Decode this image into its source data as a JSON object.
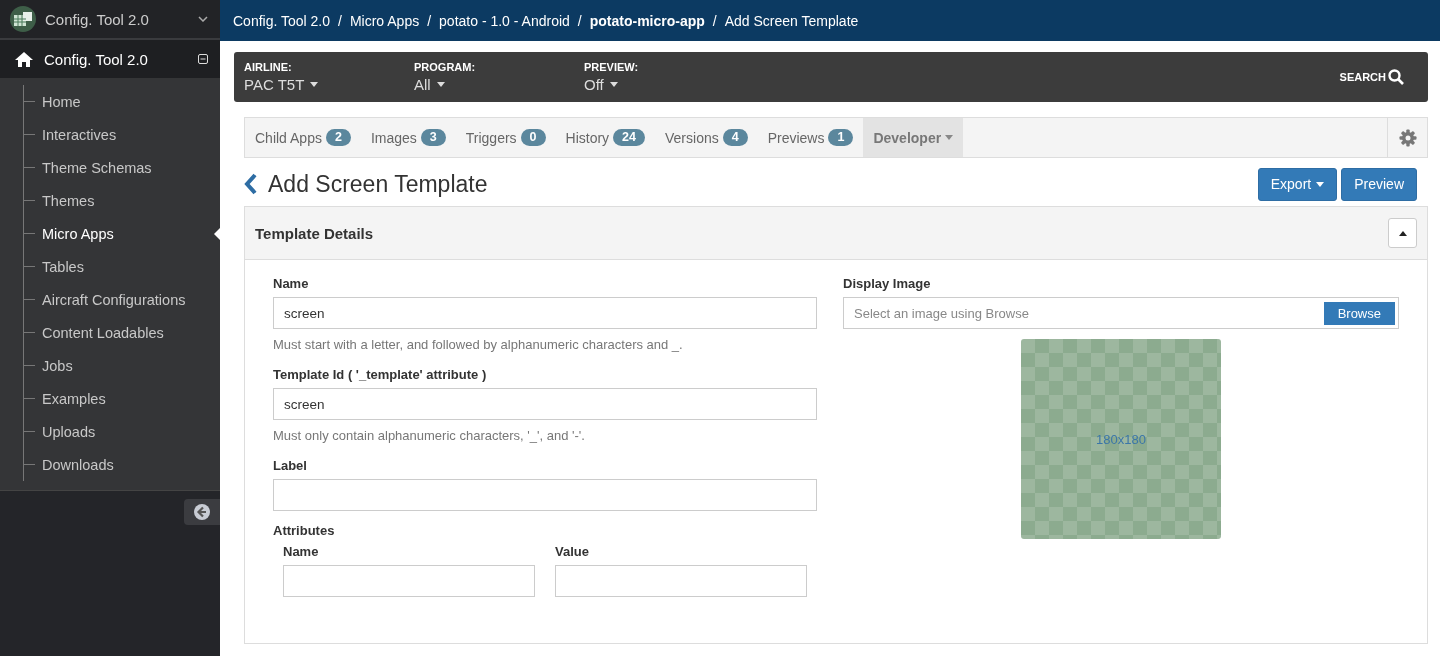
{
  "app_switcher": {
    "title": "Config. Tool 2.0"
  },
  "sidebar": {
    "root": {
      "label": "Config. Tool 2.0",
      "expanded": true
    },
    "items": [
      {
        "label": "Home",
        "selected": false
      },
      {
        "label": "Interactives",
        "selected": false
      },
      {
        "label": "Theme Schemas",
        "selected": false
      },
      {
        "label": "Themes",
        "selected": false
      },
      {
        "label": "Micro Apps",
        "selected": true
      },
      {
        "label": "Tables",
        "selected": false
      },
      {
        "label": "Aircraft Configurations",
        "selected": false
      },
      {
        "label": "Content Loadables",
        "selected": false
      },
      {
        "label": "Jobs",
        "selected": false
      },
      {
        "label": "Examples",
        "selected": false
      },
      {
        "label": "Uploads",
        "selected": false
      },
      {
        "label": "Downloads",
        "selected": false
      }
    ]
  },
  "breadcrumb": [
    {
      "label": "Config. Tool 2.0",
      "current": false
    },
    {
      "separator": "/",
      "label": "Micro Apps",
      "current": false
    },
    {
      "separator": "/",
      "label": "potato - 1.0 - Android",
      "current": false
    },
    {
      "separator": "/",
      "label": "potato-micro-app",
      "current": true
    },
    {
      "separator": "/",
      "label": "Add Screen Template",
      "current": false
    }
  ],
  "filters": [
    {
      "label": "AIRLINE:",
      "value": "PAC T5T"
    },
    {
      "label": "PROGRAM:",
      "value": "All"
    },
    {
      "label": "PREVIEW:",
      "value": "Off"
    }
  ],
  "search": {
    "label": "SEARCH"
  },
  "tabs": [
    {
      "kind": "counted",
      "label": "Child Apps",
      "count": "2",
      "selected": false
    },
    {
      "kind": "counted",
      "label": "Images",
      "count": "3",
      "selected": false
    },
    {
      "kind": "counted",
      "label": "Triggers",
      "count": "0",
      "selected": false
    },
    {
      "kind": "counted",
      "label": "History",
      "count": "24",
      "selected": false
    },
    {
      "kind": "counted",
      "label": "Versions",
      "count": "4",
      "selected": false
    },
    {
      "kind": "counted",
      "label": "Previews",
      "count": "1",
      "selected": false
    },
    {
      "kind": "dropdown",
      "label": "Developer",
      "selected": true
    }
  ],
  "page_title": "Add Screen Template",
  "buttons": [
    {
      "label": "Export",
      "dropdown": true
    },
    {
      "label": "Preview",
      "dropdown": false
    }
  ],
  "panel": {
    "title": "Template Details",
    "expanded": true,
    "fields": [
      {
        "label": "Name",
        "value": "screen",
        "help": "Must start with a letter, and followed by alphanumeric characters and _."
      },
      {
        "label": "Template Id ( '_template' attribute )",
        "value": "screen",
        "help": "Must only contain alphanumeric characters, '_', and '-'."
      },
      {
        "label": "Label"
      }
    ],
    "attributes": {
      "title": "Attributes",
      "columns": [
        {
          "label": "Name"
        },
        {
          "label": "Value"
        }
      ]
    },
    "display_image": {
      "label": "Display Image",
      "placeholder": "Select an image using Browse",
      "button": "Browse",
      "preview_text": "180x180"
    }
  }
}
